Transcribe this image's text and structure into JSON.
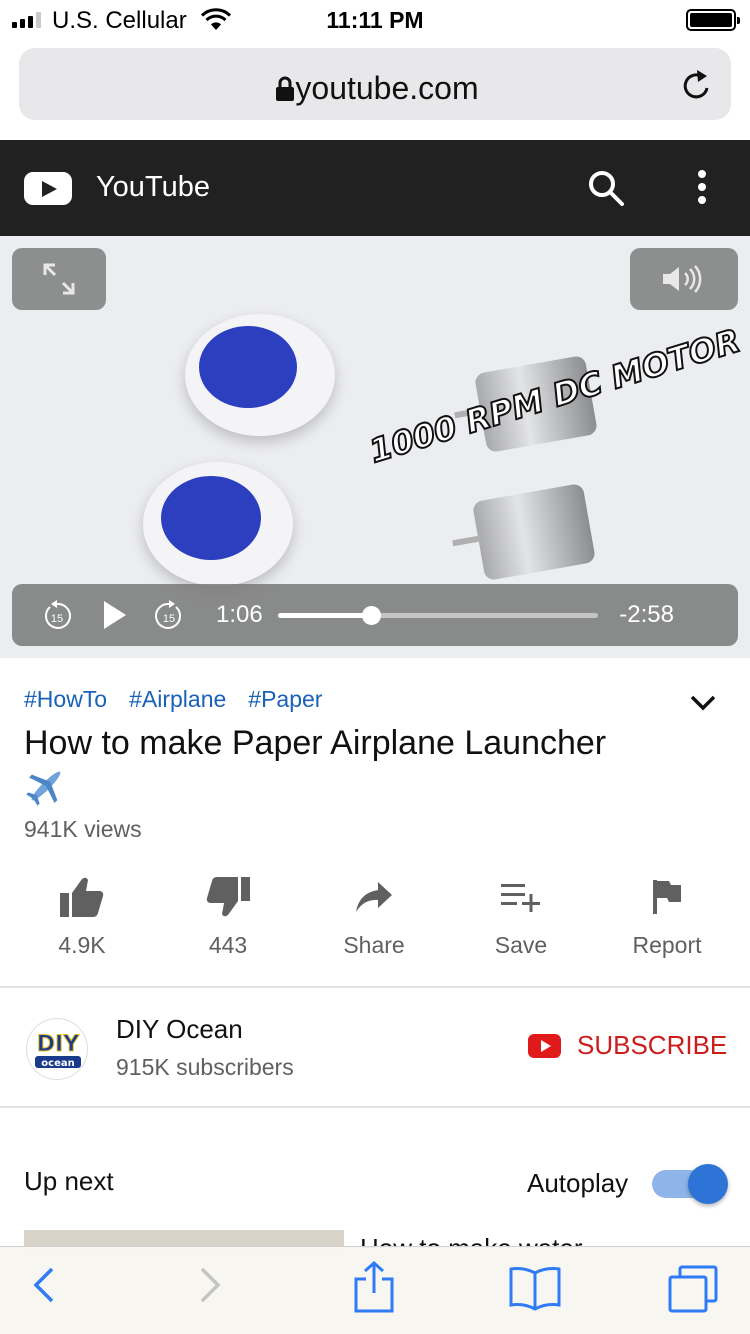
{
  "status_bar": {
    "carrier": "U.S. Cellular",
    "time": "11:11 PM"
  },
  "browser": {
    "url": "youtube.com"
  },
  "youtube_header": {
    "title": "YouTube"
  },
  "video": {
    "overlay_text": "1000 RPM DC MOTOR",
    "elapsed": "1:06",
    "remaining": "-2:58",
    "progress": 0.29,
    "skip_seconds": "15"
  },
  "video_info": {
    "tags": [
      "#HowTo",
      "#Airplane",
      "#Paper"
    ],
    "title": "How to make Paper Airplane Launcher",
    "title_emoji": "✈️",
    "views": "941K views"
  },
  "actions": {
    "like": "4.9K",
    "dislike": "443",
    "share": "Share",
    "save": "Save",
    "report": "Report"
  },
  "channel": {
    "name": "DIY Ocean",
    "subscribers": "915K subscribers",
    "logo_text": "DIY",
    "logo_subtext": "ocean",
    "subscribe_label": "SUBSCRIBE"
  },
  "up_next": {
    "heading": "Up next",
    "autoplay_label": "Autoplay",
    "autoplay_on": true,
    "next_title": "How to make water"
  },
  "colors": {
    "youtube_header": "#212121",
    "link_blue": "#1a61b8",
    "subscribe_red": "#cc1c1c",
    "toggle_blue": "#2e74d6"
  }
}
